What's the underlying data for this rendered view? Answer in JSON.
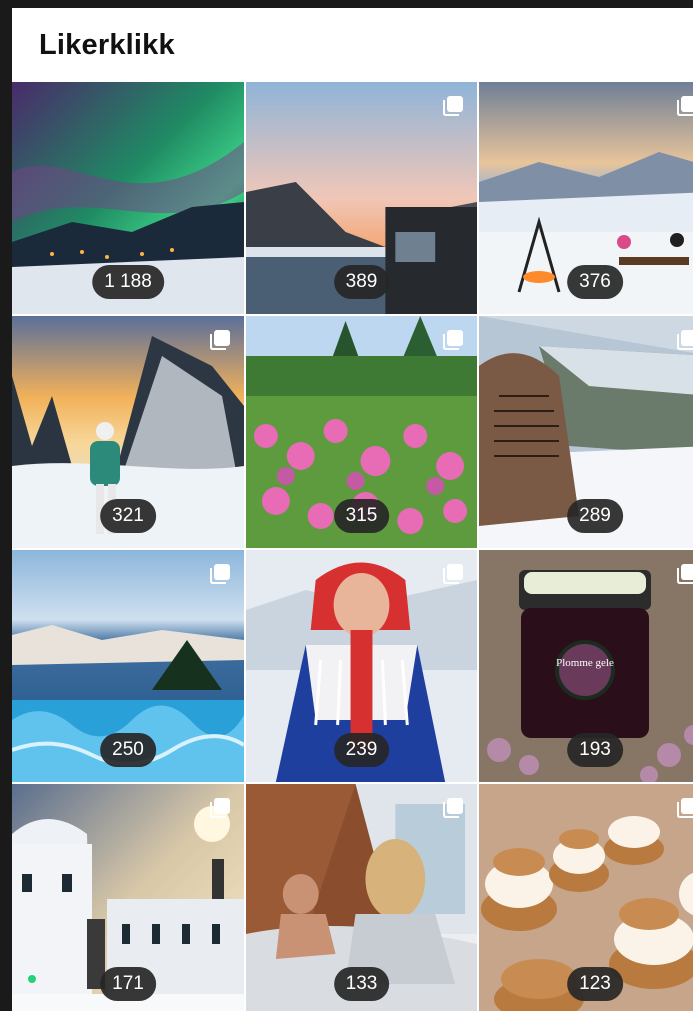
{
  "header": {
    "title": "Likerklikk"
  },
  "tiles": [
    {
      "scene": "aurora-village",
      "likes": "1 188",
      "multi": false
    },
    {
      "scene": "fjord-sunset-cabin",
      "likes": "389",
      "multi": true
    },
    {
      "scene": "winter-fire-pit",
      "likes": "376",
      "multi": true
    },
    {
      "scene": "skier-snowy-trees",
      "likes": "321",
      "multi": true
    },
    {
      "scene": "pink-flower-garden",
      "likes": "315",
      "multi": true
    },
    {
      "scene": "rune-stone-snow",
      "likes": "289",
      "multi": true
    },
    {
      "scene": "hot-tub-archipelago",
      "likes": "250",
      "multi": true
    },
    {
      "scene": "woman-sami-costume",
      "likes": "239",
      "multi": true
    },
    {
      "scene": "plum-jelly-jar",
      "likes": "193",
      "multi": true
    },
    {
      "scene": "white-manor-winter",
      "likes": "171",
      "multi": true
    },
    {
      "scene": "couple-in-bed-cabin",
      "likes": "133",
      "multi": true
    },
    {
      "scene": "cream-buns",
      "likes": "123",
      "multi": true
    }
  ],
  "jar_label": "Plomme gele",
  "icons": {
    "multi_post": "multiple-images-icon"
  }
}
